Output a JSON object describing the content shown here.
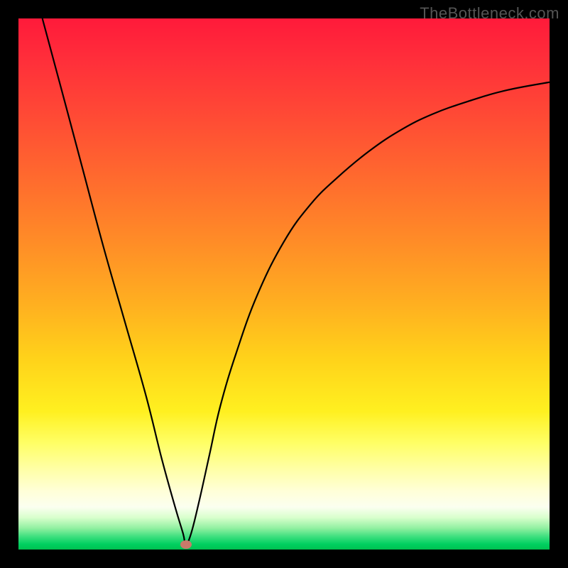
{
  "watermark": "TheBottleneck.com",
  "chart_data": {
    "type": "line",
    "title": "",
    "xlabel": "",
    "ylabel": "",
    "xlim": [
      0,
      100
    ],
    "ylim": [
      0,
      100
    ],
    "grid": false,
    "legend": false,
    "marker": {
      "x": 31.5,
      "y": 1.0,
      "color": "#c97a6a"
    },
    "series": [
      {
        "name": "curve",
        "color": "#000000",
        "x": [
          4.5,
          8,
          12,
          16,
          20,
          24,
          27,
          29.5,
          31,
          31.5,
          32.5,
          34,
          36,
          38,
          41,
          45,
          50,
          55,
          60,
          66,
          72,
          78,
          85,
          92,
          100
        ],
        "y": [
          100,
          87,
          72,
          57,
          43,
          29,
          17,
          8,
          3,
          1,
          3,
          9,
          18,
          27,
          37,
          48,
          58,
          65,
          70,
          75,
          79,
          82,
          84.5,
          86.5,
          88
        ]
      }
    ],
    "background_gradient": {
      "stops": [
        {
          "pos": 0,
          "color": "#ff1a3a"
        },
        {
          "pos": 18,
          "color": "#ff4935"
        },
        {
          "pos": 42,
          "color": "#ff8c27"
        },
        {
          "pos": 64,
          "color": "#ffd21a"
        },
        {
          "pos": 80,
          "color": "#ffff66"
        },
        {
          "pos": 92,
          "color": "#fbfff0"
        },
        {
          "pos": 100,
          "color": "#00c050"
        }
      ]
    }
  }
}
